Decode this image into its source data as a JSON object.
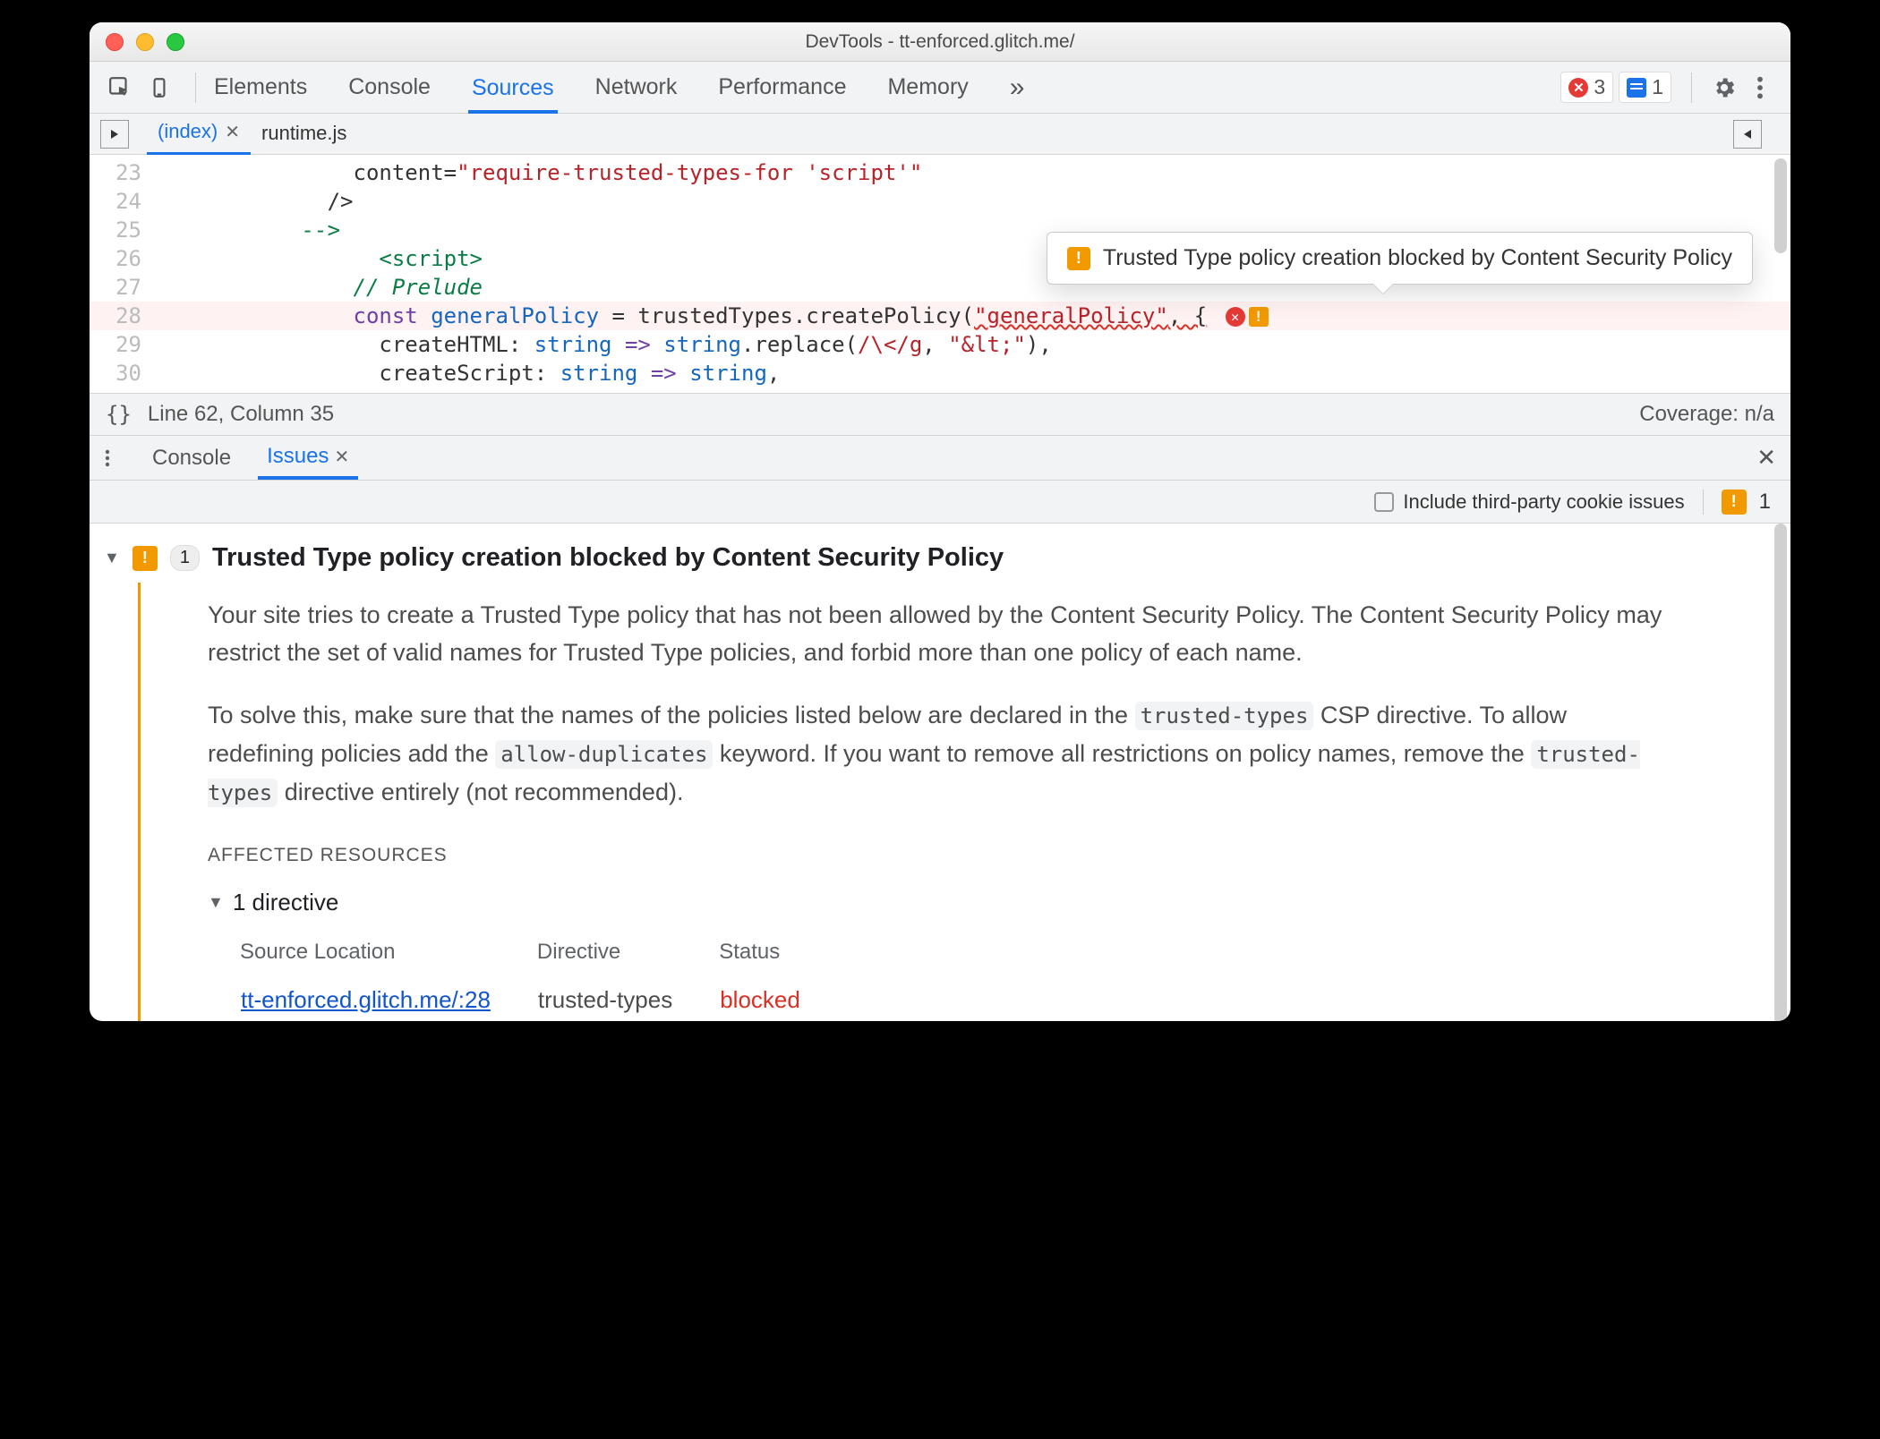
{
  "window": {
    "title": "DevTools - tt-enforced.glitch.me/"
  },
  "tabs": {
    "items": [
      "Elements",
      "Console",
      "Sources",
      "Network",
      "Performance",
      "Memory"
    ],
    "active": "Sources",
    "overflow": "»"
  },
  "toolbar_badges": {
    "errors": "3",
    "messages": "1"
  },
  "file_tabs": {
    "items": [
      "(index)",
      "runtime.js"
    ],
    "active": "(index)"
  },
  "code": {
    "lines": [
      {
        "n": "23",
        "html": "content=<span class='tk-str'>\"require-trusted-types-for 'script'\"</span>"
      },
      {
        "n": "24",
        "html": "/&gt;"
      },
      {
        "n": "25",
        "html": "<span class='tk-comm'>--&gt;</span>"
      },
      {
        "n": "26",
        "html": "<span class='tk-tag'>&lt;script&gt;</span>"
      },
      {
        "n": "27",
        "html": "<span class='tk-comm'>// Prelude</span>"
      },
      {
        "n": "28",
        "hl": true,
        "html": "<span class='tk-key'>const</span> <span class='tk-var'>generalPolicy</span> = trustedTypes.createPolicy(<span class='tk-str squiggle'>\"generalPolicy\"</span><span class='squiggle'>,&nbsp;{</span>",
        "icons": true
      },
      {
        "n": "29",
        "html": "createHTML: <span class='tk-var'>string</span> <span class='tk-key'>=&gt;</span> <span class='tk-var'>string</span>.replace(<span class='tk-reg'>/\\&lt;/g</span>, <span class='tk-str'>\"&amp;lt;\"</span>),"
      },
      {
        "n": "30",
        "html": "createScript: <span class='tk-var'>string</span> <span class='tk-key'>=&gt;</span> <span class='tk-var'>string</span>,"
      }
    ],
    "indent": [
      5,
      4,
      3,
      6,
      5,
      5,
      6,
      6
    ]
  },
  "tooltip": {
    "text": "Trusted Type policy creation blocked by Content Security Policy"
  },
  "status": {
    "left_icon": "{}",
    "pos": "Line 62, Column 35",
    "coverage": "Coverage: n/a"
  },
  "drawer": {
    "tabs": [
      "Console",
      "Issues"
    ],
    "active": "Issues"
  },
  "issues_opts": {
    "checkbox_label": "Include third-party cookie issues",
    "warn_count": "1"
  },
  "issue": {
    "count": "1",
    "title": "Trusted Type policy creation blocked by Content Security Policy",
    "p1_a": "Your site tries to create a Trusted Type policy that has not been allowed by the Content Security Policy. The Content Security Policy may restrict the set of valid names for Trusted Type policies, and forbid more than one policy of each name.",
    "p2_a": "To solve this, make sure that the names of the policies listed below are declared in the ",
    "code1": "trusted-types",
    "p2_b": " CSP directive. To allow redefining policies add the ",
    "code2": "allow-duplicates",
    "p2_c": " keyword. If you want to remove all restrictions on policy names, remove the ",
    "code3": "trusted-types",
    "p2_d": " directive entirely (not recommended).",
    "affected_label": "AFFECTED RESOURCES",
    "dir_summary": "1 directive",
    "table": {
      "headers": [
        "Source Location",
        "Directive",
        "Status"
      ],
      "row": {
        "loc": "tt-enforced.glitch.me/:28",
        "dir": "trusted-types",
        "status": "blocked"
      }
    }
  }
}
